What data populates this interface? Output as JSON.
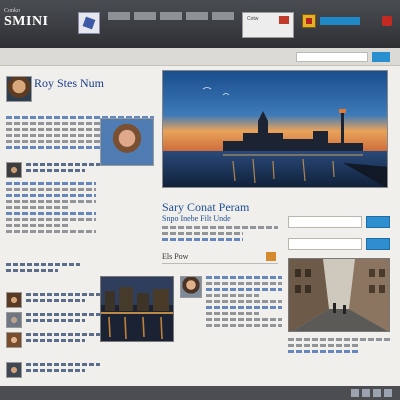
{
  "header": {
    "logo_small": "Conko",
    "logo_big": "SMINI",
    "nav": [
      "",
      "",
      "",
      "",
      "",
      "",
      ""
    ],
    "promo_label": "Cotw",
    "user_label": "",
    "colors": {
      "bar": "#3a3c40",
      "accent": "#2a8fcf",
      "alert": "#c0392b"
    }
  },
  "strip": {
    "search_placeholder": ""
  },
  "profile": {
    "name": "Roy Stes Num",
    "subtitle": ""
  },
  "feature": {
    "title": "Sary Conat Peram",
    "subtitle": "Snpo Inebe Filt Unde"
  },
  "section": {
    "label": "Els Pow"
  },
  "footer": {
    "links": [
      "",
      "",
      "",
      "",
      "",
      "",
      "",
      "",
      ""
    ]
  }
}
